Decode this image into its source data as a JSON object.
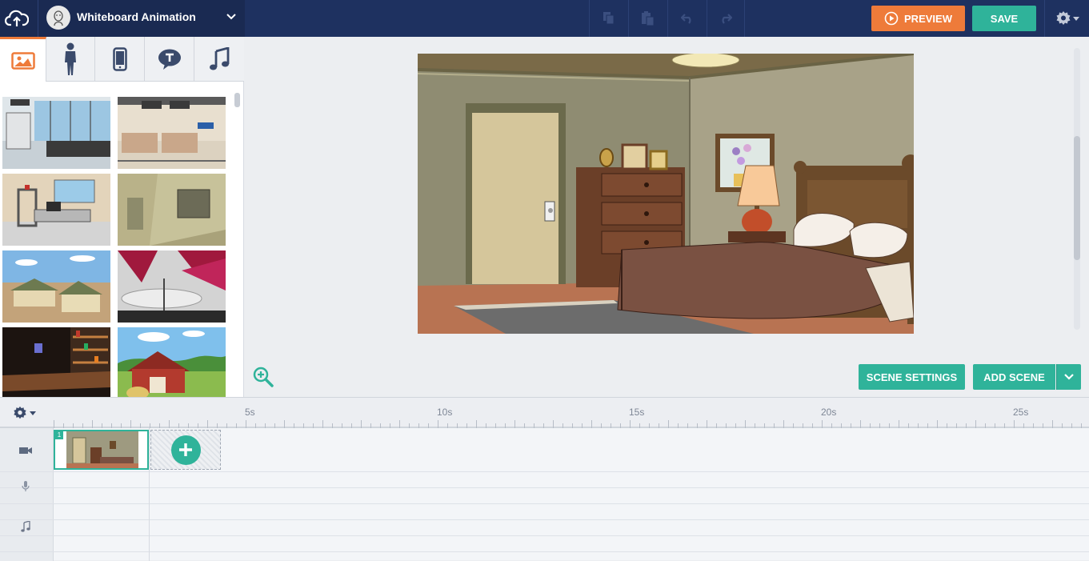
{
  "header": {
    "project_title": "Whiteboard Animation",
    "preview_label": "PREVIEW",
    "save_label": "SAVE",
    "icons": [
      "cloud-upload-icon",
      "project-avatar-icon",
      "chevron-down-icon",
      "copy-icon",
      "paste-icon",
      "undo-icon",
      "redo-icon",
      "gear-icon"
    ]
  },
  "library": {
    "tabs": [
      {
        "name": "backgrounds",
        "icon": "image-icon",
        "active": true
      },
      {
        "name": "characters",
        "icon": "person-icon",
        "active": false
      },
      {
        "name": "props",
        "icon": "phone-icon",
        "active": false
      },
      {
        "name": "text",
        "icon": "speech-bubble-icon",
        "active": false
      },
      {
        "name": "music",
        "icon": "music-note-icon",
        "active": false
      }
    ],
    "thumbnails": [
      "airport-terminal",
      "airport-checkin",
      "security-checkpoint",
      "tent-interior",
      "desert-village",
      "stage-studio",
      "bar-interior",
      "red-barn-farm"
    ]
  },
  "canvas": {
    "scene_name": "bedroom",
    "scene_settings_label": "SCENE SETTINGS",
    "add_scene_label": "ADD SCENE"
  },
  "timeline": {
    "ticks": [
      "5s",
      "10s",
      "15s",
      "20s",
      "25s"
    ],
    "tracks": [
      "camera-icon",
      "microphone-icon",
      "music-note-icon"
    ],
    "scenes": [
      {
        "number": "1"
      }
    ]
  },
  "colors": {
    "topbar": "#1e3160",
    "accent_orange": "#ee7b3a",
    "accent_teal": "#2fb39a"
  }
}
